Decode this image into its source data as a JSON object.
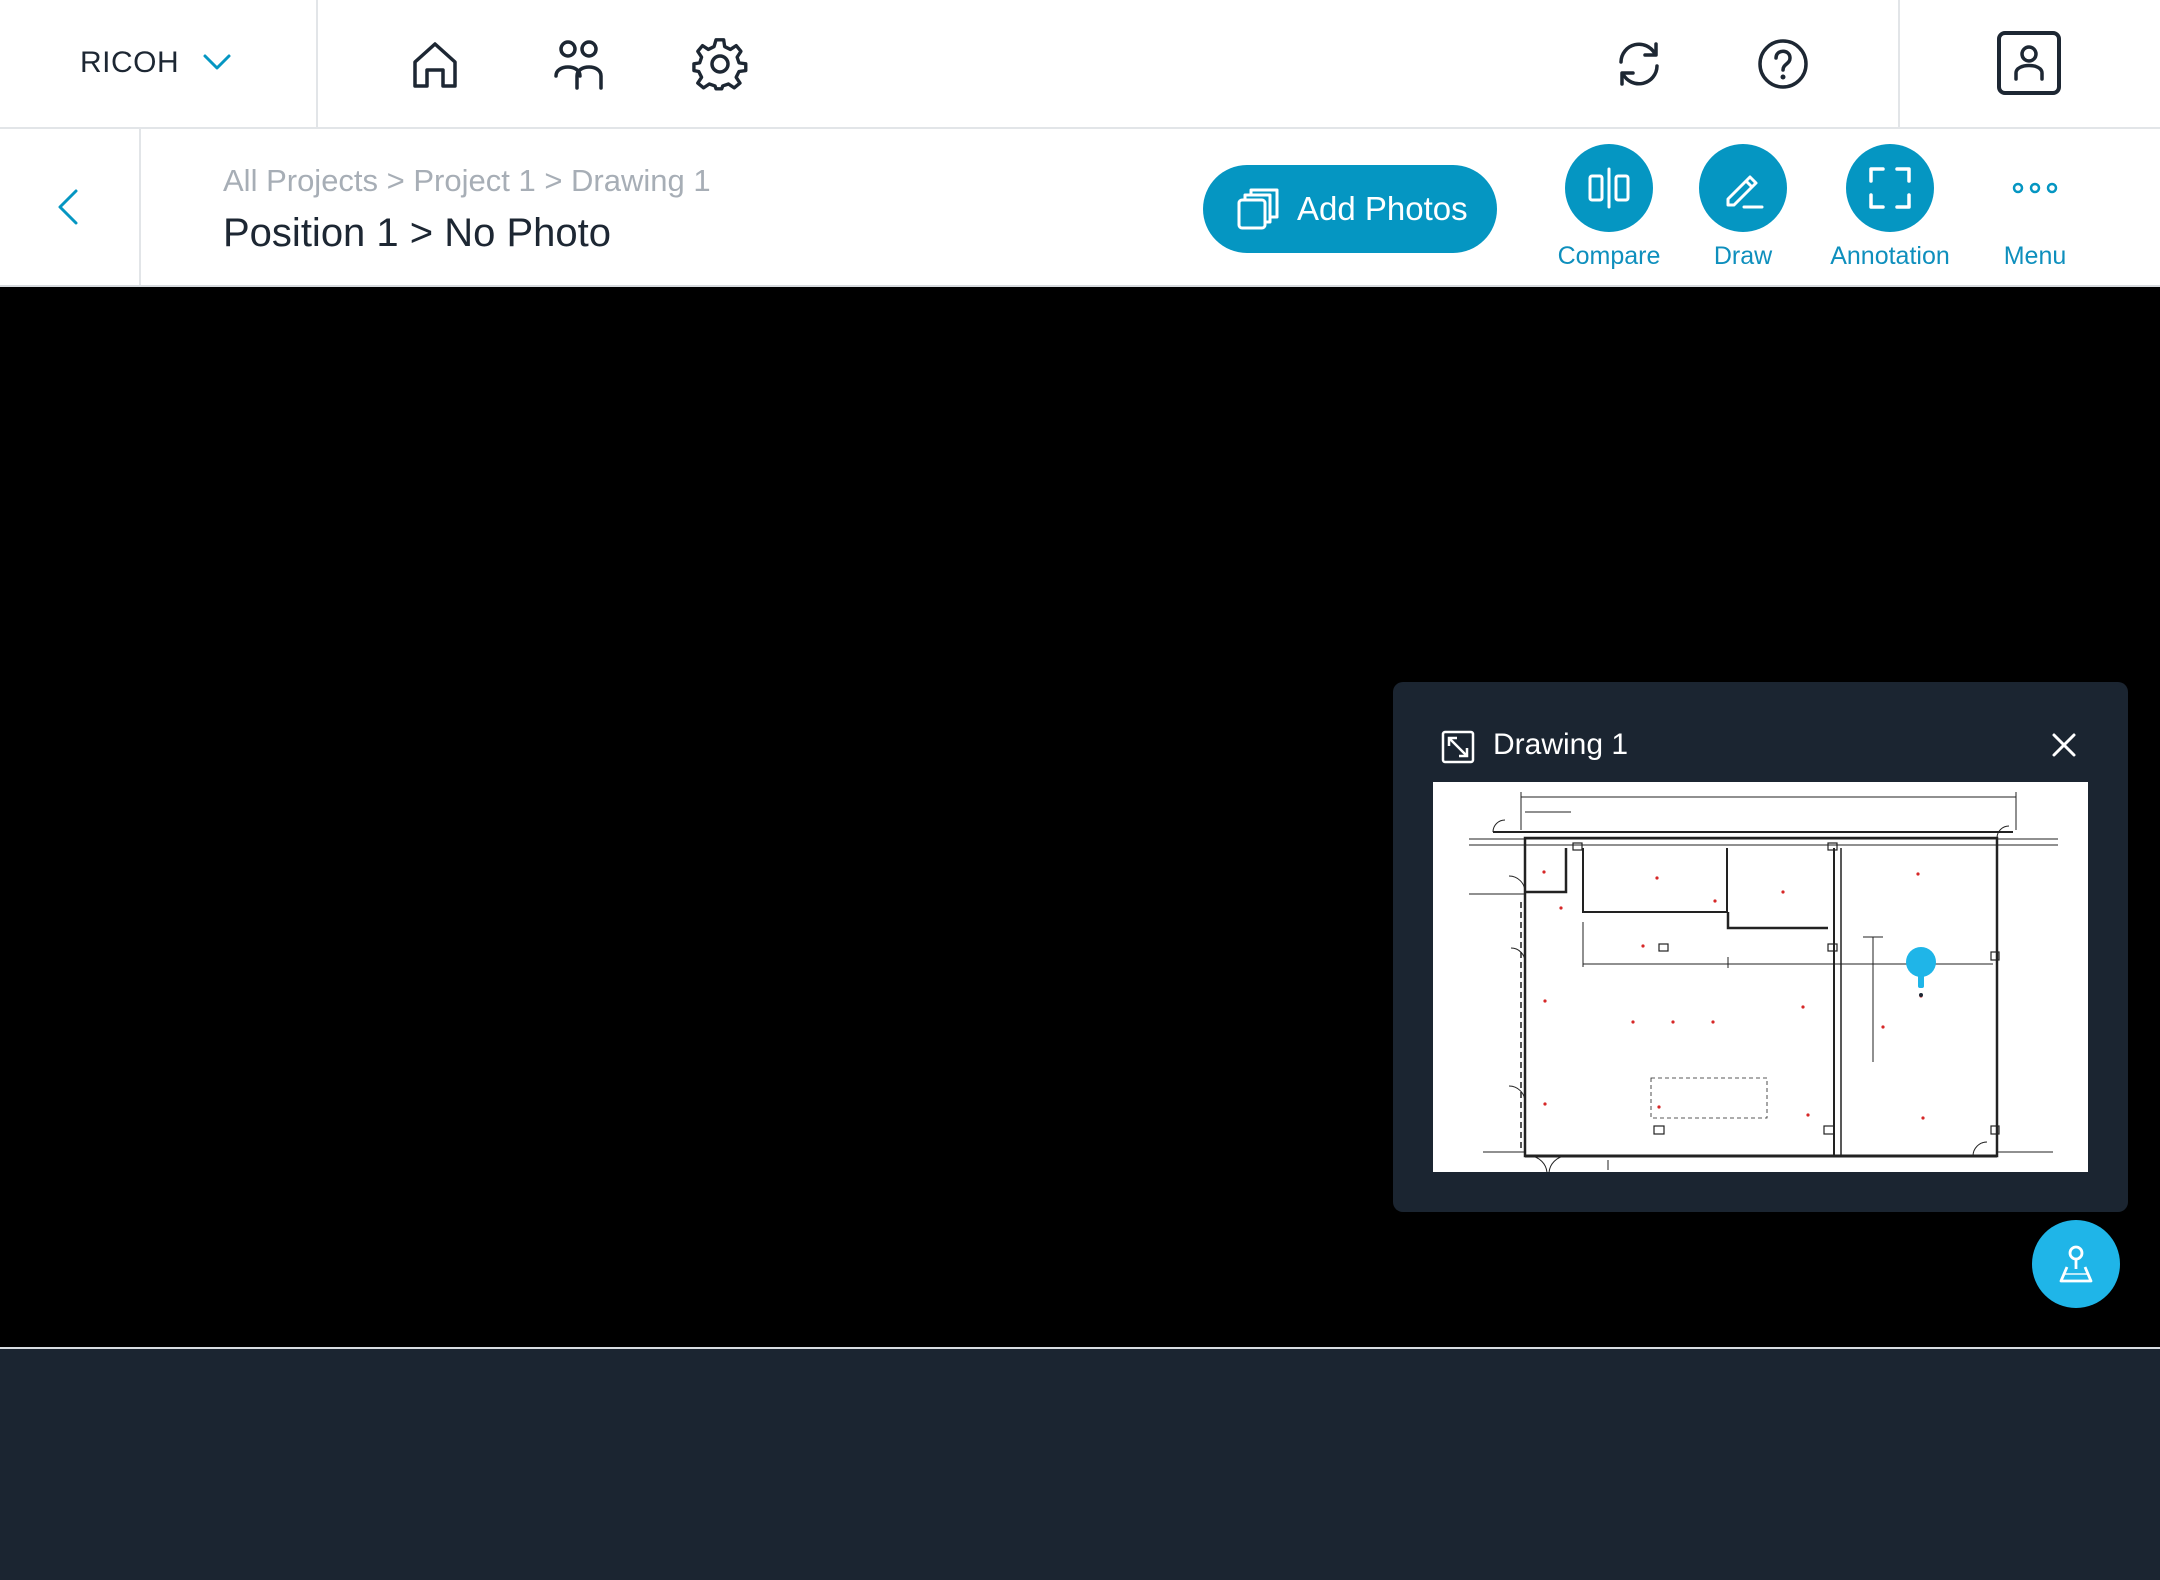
{
  "topbar": {
    "org_name": "RICOH",
    "nav_icons": [
      "home-icon",
      "users-icon",
      "gear-icon"
    ],
    "right_icons": [
      "sync-icon",
      "help-icon",
      "profile-icon"
    ]
  },
  "header": {
    "breadcrumb": "All Projects > Project 1 > Drawing 1",
    "title": "Position 1 > No Photo",
    "add_photos_label": "Add Photos",
    "tools": [
      {
        "label": "Compare",
        "icon": "compare-icon"
      },
      {
        "label": "Draw",
        "icon": "pencil-icon"
      },
      {
        "label": "Annotation",
        "icon": "annotation-frame-icon"
      },
      {
        "label": "Menu",
        "icon": "more-dots-icon"
      }
    ]
  },
  "minimap": {
    "title": "Drawing 1",
    "pin_color": "#1fb5e8"
  },
  "colors": {
    "accent": "#0596c2",
    "accent_light": "#1fb5e8",
    "panel": "#1b2531",
    "text_dark": "#1d2733",
    "text_muted": "#a7aeb6"
  }
}
